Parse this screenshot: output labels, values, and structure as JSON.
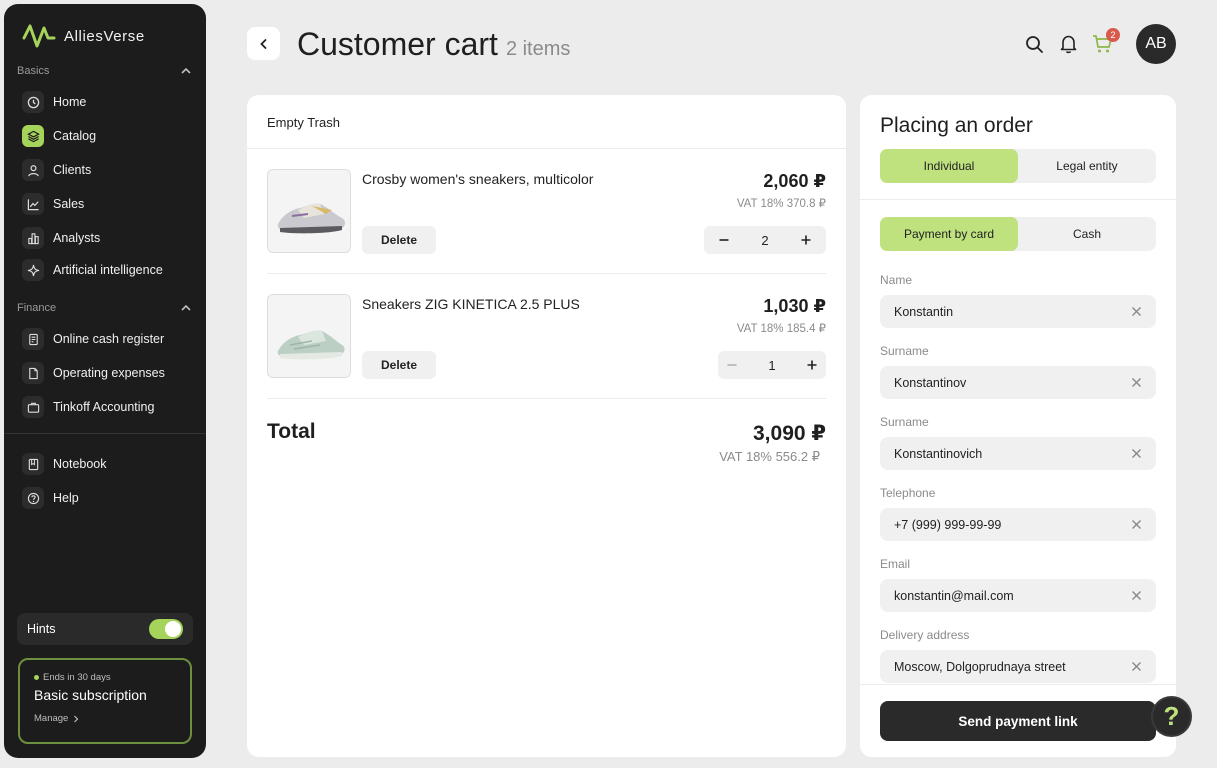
{
  "app": {
    "name": "AlliesVerse"
  },
  "sidebar": {
    "sections": [
      {
        "label": "Basics"
      },
      {
        "label": "Finance"
      }
    ],
    "basics_items": [
      {
        "label": "Home",
        "icon": "clock-icon"
      },
      {
        "label": "Catalog",
        "icon": "layers-icon",
        "active": true
      },
      {
        "label": "Clients",
        "icon": "user-icon"
      },
      {
        "label": "Sales",
        "icon": "chart-line-icon"
      },
      {
        "label": "Analysts",
        "icon": "bar-chart-icon"
      },
      {
        "label": "Artificial intelligence",
        "icon": "sparkle-icon"
      }
    ],
    "finance_items": [
      {
        "label": "Online cash register",
        "icon": "register-icon"
      },
      {
        "label": "Operating expenses",
        "icon": "document-icon"
      },
      {
        "label": "Tinkoff Accounting",
        "icon": "briefcase-icon"
      }
    ],
    "other_items": [
      {
        "label": "Notebook",
        "icon": "notebook-icon"
      },
      {
        "label": "Help",
        "icon": "help-icon"
      }
    ],
    "hints": {
      "label": "Hints",
      "enabled": true
    },
    "subscription": {
      "ends": "Ends in 30 days",
      "title": "Basic subscription",
      "manage": "Manage"
    }
  },
  "header": {
    "title": "Customer cart",
    "count": "2 items",
    "cart_badge": "2",
    "avatar": "AB"
  },
  "cart": {
    "empty_trash": "Empty Trash",
    "items": [
      {
        "name": "Crosby women's sneakers, multicolor",
        "price": "2,060 ₽",
        "vat": "VAT 18% 370.8 ₽",
        "quantity": "2",
        "delete_label": "Delete"
      },
      {
        "name": "Sneakers ZIG KINETICA 2.5 PLUS",
        "price": "1,030 ₽",
        "vat": "VAT 18% 185.4 ₽",
        "quantity": "1",
        "delete_label": "Delete"
      }
    ],
    "total_label": "Total",
    "total_price": "3,090 ₽",
    "total_vat": "VAT 18% 556.2 ₽"
  },
  "order": {
    "title": "Placing an order",
    "customer_type": {
      "options": [
        "Individual",
        "Legal entity"
      ],
      "selected": "Individual"
    },
    "payment": {
      "options": [
        "Payment by card",
        "Cash"
      ],
      "selected": "Payment by card"
    },
    "fields": [
      {
        "label": "Name",
        "value": "Konstantin"
      },
      {
        "label": "Surname",
        "value": "Konstantinov"
      },
      {
        "label": "Surname",
        "value": "Konstantinovich"
      },
      {
        "label": "Telephone",
        "value": "+7 (999) 999-99-99"
      },
      {
        "label": "Email",
        "value": "konstantin@mail.com"
      },
      {
        "label": "Delivery address",
        "value": "Moscow, Dolgoprudnaya street"
      }
    ],
    "send_label": "Send payment link"
  },
  "help_fab": "?",
  "colors": {
    "accent": "#bfe27e",
    "accent_dark": "#a6d45b",
    "sidebar_bg": "#1c1c1c",
    "badge": "#d85a4c"
  }
}
